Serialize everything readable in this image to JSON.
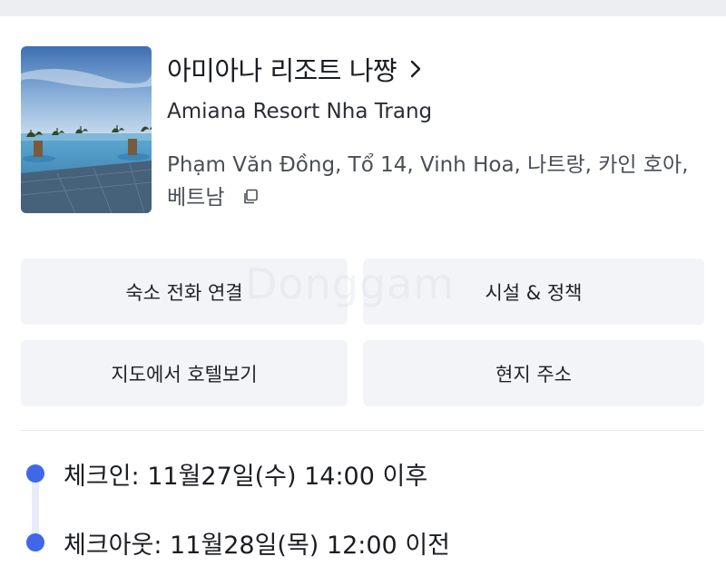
{
  "hotel": {
    "name_ko": "아미아나 리조트 나쨩",
    "name_en": "Amiana Resort Nha Trang",
    "address": "Phạm Văn Đồng, Tổ 14, Vinh Hoa, 나트랑, 카인 호아, 베트남"
  },
  "actions": {
    "call_label": "숙소 전화 연결",
    "facility_label": "시설 & 정책",
    "map_label": "지도에서 호텔보기",
    "local_address_label": "현지 주소"
  },
  "schedule": {
    "checkin": "체크인: 11월27일(수) 14:00 이후",
    "checkout": "체크아웃: 11월28일(목) 12:00 이전"
  },
  "watermark": "Donggam",
  "colors": {
    "accent": "#3f67e8",
    "button_bg": "#f3f4f7",
    "text_primary": "#1b1d22",
    "text_secondary": "#4a4e57"
  },
  "icons": [
    "chevron-right-icon",
    "copy-icon"
  ]
}
